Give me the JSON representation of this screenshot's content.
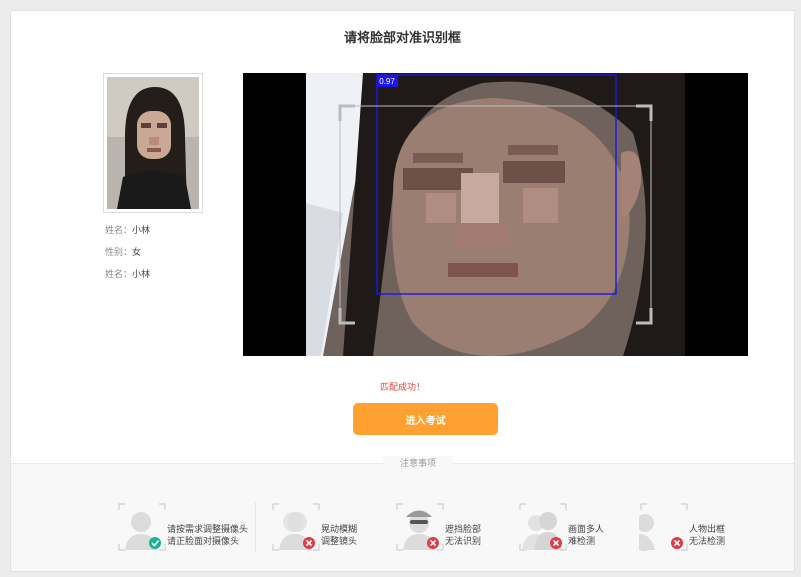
{
  "page": {
    "title": "请将脸部对准识别框"
  },
  "profile": {
    "rows": [
      {
        "label": "姓名：",
        "value": "小林"
      },
      {
        "label": "性别：",
        "value": "女"
      },
      {
        "label": "姓名：",
        "value": "小林"
      }
    ]
  },
  "camera": {
    "score_label": "0.97",
    "face_box_color": "#1c17e8"
  },
  "match": {
    "status": "匹配成功！"
  },
  "actions": {
    "enter_exam_label": "进入考试"
  },
  "colors": {
    "accent": "#ffa030",
    "success": "#1bb394",
    "error": "#e03c46",
    "status_text": "#e0443a"
  },
  "notes": {
    "title": "注意事项",
    "tips": [
      {
        "line1": "请按需求调整摄像头",
        "line2": "请正脸面对摄像头",
        "status_icon": "check-icon"
      },
      {
        "line1": "晃动模糊",
        "line2": "调整镜头",
        "status_icon": "error-icon"
      },
      {
        "line1": "遮挡脸部",
        "line2": "无法识别",
        "status_icon": "error-icon"
      },
      {
        "line1": "画面多人",
        "line2": "难检测",
        "status_icon": "error-icon"
      },
      {
        "line1": "人物出框",
        "line2": "无法检测",
        "status_icon": "error-icon"
      }
    ]
  }
}
